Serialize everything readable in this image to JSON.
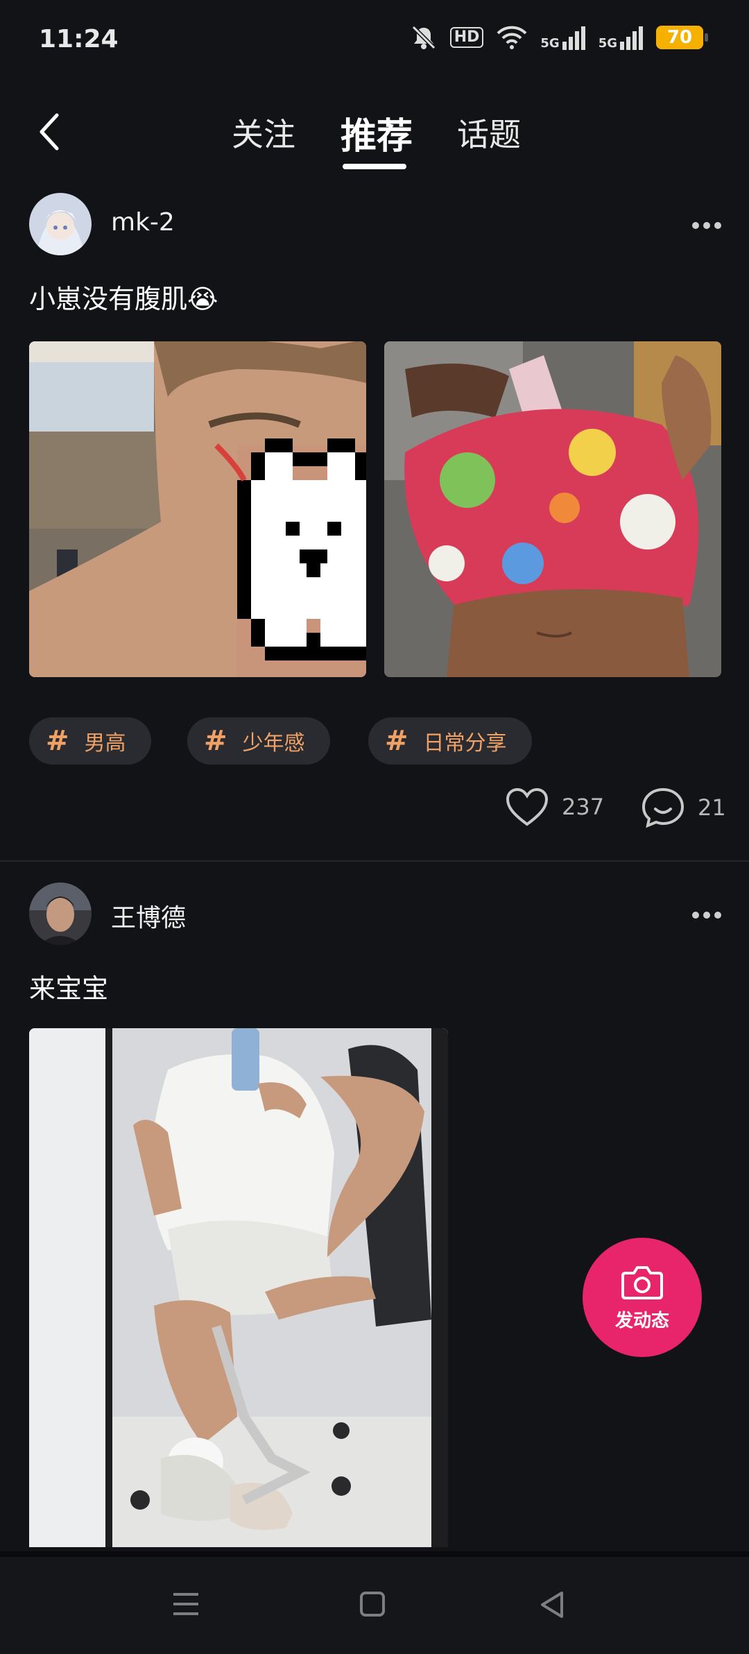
{
  "status_bar": {
    "time": "11:24",
    "hd_label": "HD",
    "net1": "5G",
    "net2": "5G",
    "battery": "70",
    "icons": [
      "mute-icon",
      "wifi-icon",
      "signal-icon",
      "signal-icon",
      "battery-icon"
    ]
  },
  "nav": {
    "tabs": [
      {
        "label": "关注"
      },
      {
        "label": "推荐"
      },
      {
        "label": "话题"
      }
    ],
    "active_tab": "推荐"
  },
  "posts": [
    {
      "username": "mk-2",
      "text": "小崽没有腹肌😭",
      "tags": [
        {
          "hash": "#",
          "label": "男高"
        },
        {
          "hash": "#",
          "label": "少年感"
        },
        {
          "hash": "#",
          "label": "日常分享"
        }
      ],
      "likes": "237",
      "comments": "21"
    },
    {
      "username": "王博德",
      "text": "来宝宝"
    }
  ],
  "fab": {
    "label": "发动态"
  },
  "colors": {
    "background": "#121317",
    "tag_text": "#f0a266",
    "fab": "#e8246b",
    "battery": "#f6b100"
  }
}
